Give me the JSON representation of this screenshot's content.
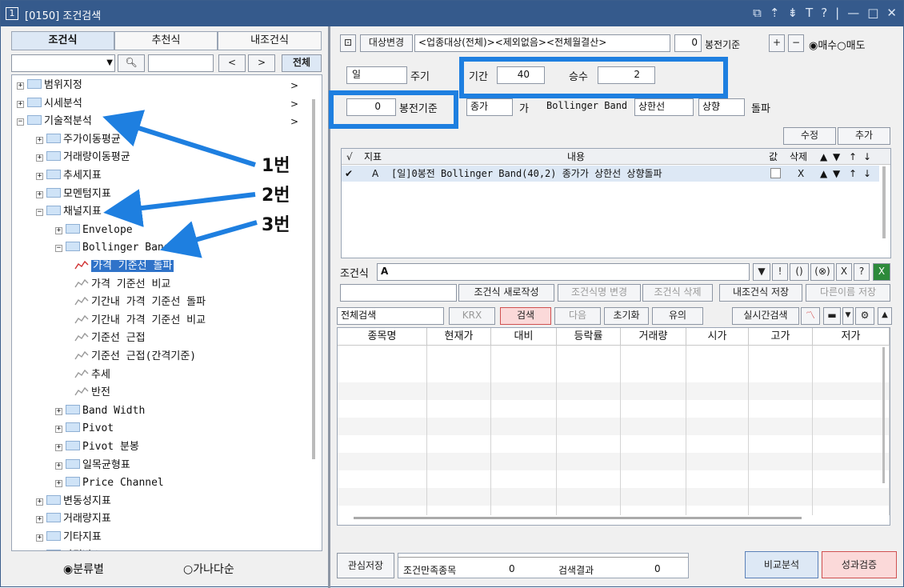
{
  "window": {
    "num": "1",
    "title": "[0150] 조건검색",
    "icons": [
      "⧉",
      "⇡",
      "⇟",
      "T",
      "?",
      "|",
      "—",
      "□",
      "✕"
    ]
  },
  "left_tabs": [
    "조건식",
    "추천식",
    "내조건식"
  ],
  "left_search": {
    "all_button": "전체",
    "prev": "<",
    "next": ">"
  },
  "tree": [
    {
      "label": "범위지정",
      "level": 0,
      "pm": "+",
      "arrow": ">"
    },
    {
      "label": "시세분석",
      "level": 0,
      "pm": "+",
      "arrow": ">"
    },
    {
      "label": "기술적분석",
      "level": 0,
      "pm": "−",
      "arrow": ">"
    },
    {
      "label": "주가이동평균",
      "level": 1,
      "pm": "+"
    },
    {
      "label": "거래량이동평균",
      "level": 1,
      "pm": "+"
    },
    {
      "label": "추세지표",
      "level": 1,
      "pm": "+"
    },
    {
      "label": "모멘텀지표",
      "level": 1,
      "pm": "+"
    },
    {
      "label": "채널지표",
      "level": 1,
      "pm": "−"
    },
    {
      "label": "Envelope",
      "level": 2,
      "pm": "+"
    },
    {
      "label": "Bollinger Band",
      "level": 2,
      "pm": "−"
    },
    {
      "label": "가격 기준선 돌파",
      "level": 3,
      "selected": true
    },
    {
      "label": "가격 기준선 비교",
      "level": 3
    },
    {
      "label": "기간내 가격 기준선 돌파",
      "level": 3
    },
    {
      "label": "기간내 가격 기준선 비교",
      "level": 3
    },
    {
      "label": "기준선 근접",
      "level": 3
    },
    {
      "label": "기준선 근접(간격기준)",
      "level": 3
    },
    {
      "label": "추세",
      "level": 3
    },
    {
      "label": "반전",
      "level": 3
    },
    {
      "label": "Band Width",
      "level": 2,
      "pm": "+"
    },
    {
      "label": "Pivot",
      "level": 2,
      "pm": "+"
    },
    {
      "label": "Pivot 분봉",
      "level": 2,
      "pm": "+"
    },
    {
      "label": "일목균형표",
      "level": 2,
      "pm": "+"
    },
    {
      "label": "Price Channel",
      "level": 2,
      "pm": "+"
    },
    {
      "label": "변동성지표",
      "level": 1,
      "pm": "+"
    },
    {
      "label": "거래량지표",
      "level": 1,
      "pm": "+"
    },
    {
      "label": "기타지표",
      "level": 1,
      "pm": "+"
    },
    {
      "label": "가격박스",
      "level": 1,
      "pm": "+"
    }
  ],
  "annotations": [
    "1번",
    "2번",
    "3번"
  ],
  "left_bottom": {
    "radio1": "분류별",
    "radio2": "가나다순"
  },
  "target": {
    "change_btn": "대상변경",
    "value": "<업종대상(전체)><제외없음><전체월결산>",
    "candle_value": "0",
    "candle_label": "봉전기준",
    "plus": "+",
    "minus": "−",
    "buy": "매수",
    "sell": "매도"
  },
  "period_row": {
    "period_select": "일",
    "period_label": "주기",
    "days_label": "기간",
    "days_value": "40",
    "mult_label": "승수",
    "mult_value": "2"
  },
  "cond_row": {
    "candle_value": "0",
    "candle_label": "봉전기준",
    "price_select": "종가",
    "ga": "가",
    "indicator": "Bollinger Band",
    "line_select": "상한선",
    "dir_select": "상향",
    "breakout": "돌파"
  },
  "edit_buttons": {
    "modify": "수정",
    "add": "추가"
  },
  "grid": {
    "headers": [
      "√",
      "지표",
      "내용",
      "값",
      "삭제",
      "▲",
      "▼",
      "↑",
      "↓"
    ],
    "rows": [
      {
        "check": "✔",
        "indicator": "A",
        "content": "[일]0봉전 Bollinger Band(40,2) 종가가 상한선 상향돌파",
        "del": "X",
        "up": "▲",
        "down": "▼",
        "top": "↑",
        "bottom": "↓"
      }
    ]
  },
  "cond_formula": {
    "label": "조건식",
    "value": "A",
    "ops": [
      "▼",
      "!",
      "(",
      ")",
      "⊗",
      "X",
      "?"
    ]
  },
  "formula_actions": [
    "조건식 새로작성",
    "조건식명 변경",
    "조건식 삭제",
    "내조건식 저장",
    "다른이름 저장"
  ],
  "search_bar": {
    "scope": "전체검색",
    "market": "KRX",
    "search": "검색",
    "next": "다음",
    "reset": "초기화",
    "note": "유의",
    "realtime": "실시간검색"
  },
  "result_columns": [
    "종목명",
    "현재가",
    "대비",
    "등락률",
    "거래량",
    "시가",
    "고가",
    "저가"
  ],
  "bottom": {
    "save": "관심저장",
    "satisfy_label": "조건만족종목",
    "satisfy_value": "0",
    "result_label": "검색결과",
    "result_value": "0",
    "compare": "비교분석",
    "verify": "성과검증"
  }
}
